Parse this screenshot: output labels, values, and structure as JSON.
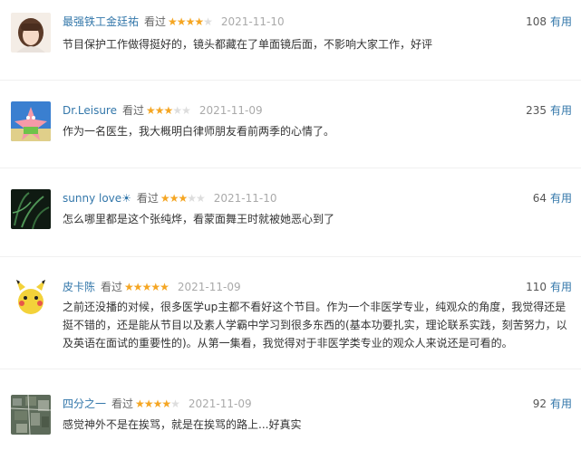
{
  "reviews": [
    {
      "username": "最强铁工金廷祐",
      "watched": "看过",
      "rating": 4,
      "date": "2021-11-10",
      "votes": "108",
      "vote_label": "有用",
      "text": "节目保护工作做得挺好的，镜头都藏在了单面镜后面，不影响大家工作，好评",
      "avatar": "portrait-avatar"
    },
    {
      "username": "Dr.Leisure",
      "watched": "看过",
      "rating": 3,
      "date": "2021-11-09",
      "votes": "235",
      "vote_label": "有用",
      "text": "作为一名医生，我大概明白律师朋友看前两季的心情了。",
      "avatar": "patrick-star-avatar"
    },
    {
      "username": "sunny love☀",
      "watched": "看过",
      "rating": 3,
      "date": "2021-11-10",
      "votes": "64",
      "vote_label": "有用",
      "text": "怎么哪里都是这个张纯烨，看蒙面舞王时就被她恶心到了",
      "avatar": "dark-plant-avatar"
    },
    {
      "username": "皮卡陈",
      "watched": "看过",
      "rating": 5,
      "date": "2021-11-09",
      "votes": "110",
      "vote_label": "有用",
      "text_lines": [
        "之前还没播的对候，很多医学up主都不看好这个节目。作为一个非医学专业，纯观众的角度，我觉得还是",
        "挺不错的，还是能从节目以及素人学霸中学习到很多东西的(基本功要扎实，理论联系实践，刻苦努力，以",
        "及英语在面试的重要性的)。从第一集看，我觉得对于非医学类专业的观众人来说还是可看的。"
      ],
      "avatar": "pikachu-avatar"
    },
    {
      "username": "四分之一",
      "watched": "看过",
      "rating": 4,
      "date": "2021-11-09",
      "votes": "92",
      "vote_label": "有用",
      "text": "感觉神外不是在挨骂，就是在挨骂的路上...好真实",
      "avatar": "city-aerial-avatar"
    }
  ],
  "colors": {
    "link": "#3377aa",
    "star_on": "#f5a623",
    "star_off": "#dddddd",
    "date": "#aaaaaa"
  }
}
